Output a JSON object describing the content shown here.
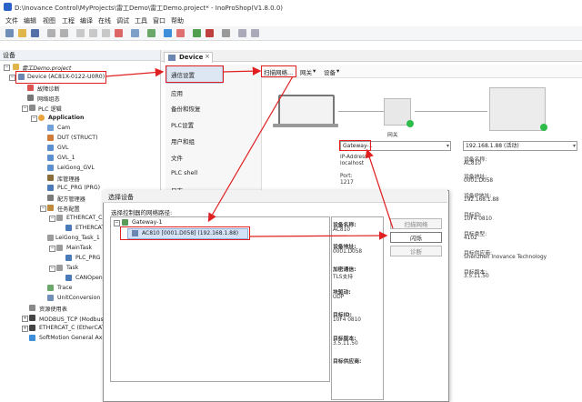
{
  "window": {
    "title": "D:\\Inovance Control\\MyProjects\\雷工Demo\\雷工Demo.project* - InoProShop(V1.8.0.0)"
  },
  "menu": [
    "文件",
    "编辑",
    "视图",
    "工程",
    "编译",
    "在线",
    "调试",
    "工具",
    "窗口",
    "帮助"
  ],
  "devices_panel": {
    "title": "设备",
    "project": "雷工Demo.project",
    "device": "Device (AC81X-0122-U0R0)",
    "items": [
      "故障诊断",
      "网络组态",
      "PLC 逻辑",
      "Application",
      "Cam",
      "DUT (STRUCT)",
      "GVL",
      "GVL_1",
      "LeiGong_GVL",
      "库管理器",
      "PLC_PRG (PRG)",
      "配方管理器",
      "任务配置",
      "ETHERCAT_C",
      "ETHERCAT_T",
      "LeiGong_Task_1",
      "MainTask",
      "PLC_PRG",
      "Task",
      "CANOpen_T",
      "Trace",
      "UnitConversion",
      "资源使用表",
      "MODBUS_TCP (ModbusTCP本",
      "ETHERCAT_C (EtherCAT Mas",
      "SoftMotion General Axis Pool"
    ]
  },
  "editor": {
    "tab": "Device",
    "nav": [
      "通信设置",
      "应用",
      "备份和恢复",
      "PLC设置",
      "用户和组",
      "文件",
      "PLC shell",
      "日志"
    ],
    "toolbar": {
      "scan": "扫描网络...",
      "gateway": "网关",
      "device": "设备"
    },
    "gateway_label": "网关",
    "gateway_select": "Gateway-1",
    "device_select": "192.168.1.88 (活动)",
    "gw_fields": [
      "IP-Address:",
      "localhost",
      "Port:",
      "1217"
    ],
    "dev_fields": [
      "设备名称:",
      "AC810",
      "设备地址:",
      "0001.D058",
      "设备IP地址:",
      "192.168.1.88",
      "目标ID:",
      "10F4 0810",
      "目标类型:",
      "4102",
      "目标供应商:",
      "Shenzhen Inovance Technology",
      "目标版本:",
      "3.5.11.50"
    ]
  },
  "dialog": {
    "title": "选择设备",
    "prompt": "选择控制器的网络路径:",
    "gateway": "Gateway-1",
    "device_row": "AC810 [0001.D058] (192.168.1.88)",
    "buttons": {
      "scan": "扫描网络",
      "wink": "闪烁",
      "info": "诊断"
    },
    "info": [
      "设备名称:",
      "AC810",
      "设备地址:",
      "0001.D058",
      "加密通信:",
      "TLS支持",
      "块驱动:",
      "UDP",
      "目标ID:",
      "10F4 0810",
      "目标版本:",
      "3.5.11.50",
      "目标供应商:"
    ]
  },
  "colors": {
    "highlight": "#e02020",
    "selection": "#d3e2f7",
    "accent": "#2a62c8"
  }
}
